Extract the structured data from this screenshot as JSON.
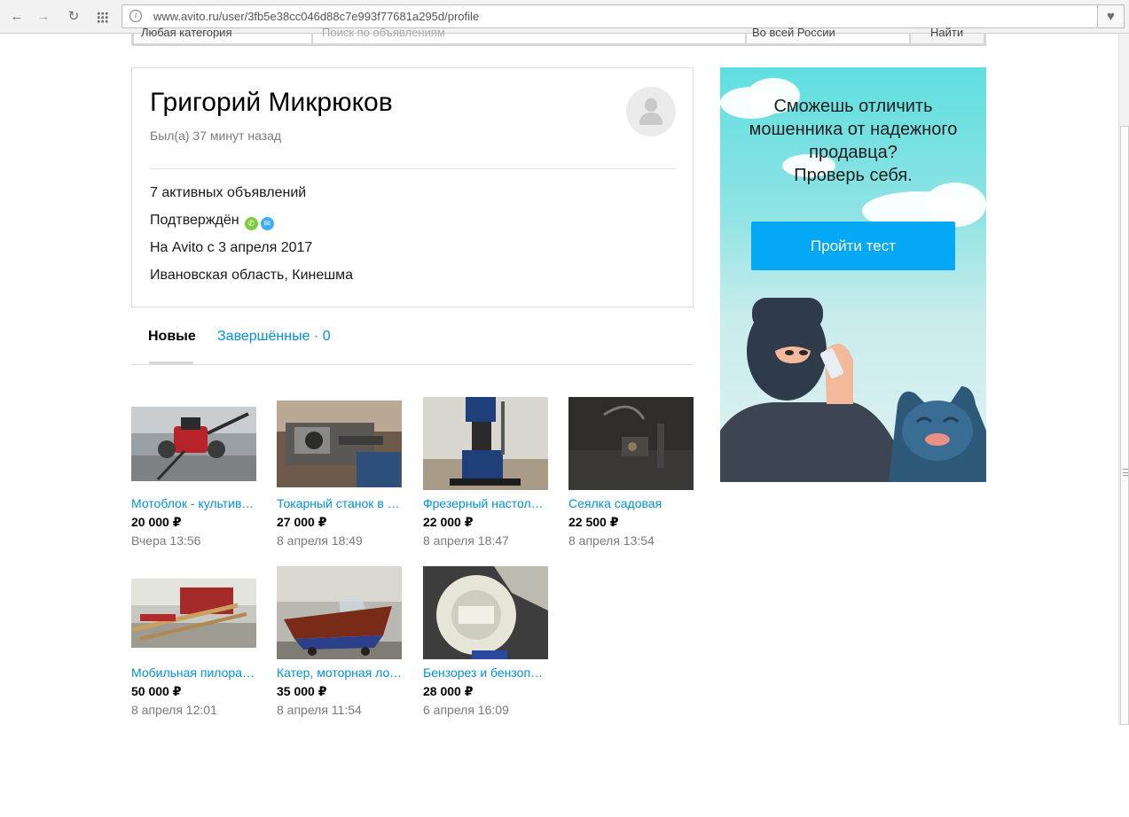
{
  "browser": {
    "url": "www.avito.ru/user/3fb5e38cc046d88c7e993f77681a295d/profile"
  },
  "search": {
    "category": "Любая категория",
    "query_placeholder": "Поиск по объявлениям",
    "region": "Во всей России",
    "button": "Найти"
  },
  "profile": {
    "name": "Григорий Микрюков",
    "last_seen": "Был(а) 37 минут назад",
    "active_ads": "7 активных объявлений",
    "verified_label": "Подтверждён",
    "since": "На Avito с 3 апреля 2017",
    "location": "Ивановская область, Кинешма"
  },
  "tabs": {
    "new": "Новые",
    "completed": "Завершённые · 0"
  },
  "listings": [
    {
      "title": "Мотоблок - культиватор",
      "price": "20 000 ₽",
      "date": "Вчера 13:56"
    },
    {
      "title": "Токарный станок в наличии",
      "price": "27 000 ₽",
      "date": "8 апреля 18:49"
    },
    {
      "title": "Фрезерный настольный станок",
      "price": "22 000 ₽",
      "date": "8 апреля 18:47"
    },
    {
      "title": "Сеялка садовая",
      "price": "22 500 ₽",
      "date": "8 апреля 13:54"
    },
    {
      "title": "Мобильная пилорама",
      "price": "50 000 ₽",
      "date": "8 апреля 12:01"
    },
    {
      "title": "Катер, моторная лодка",
      "price": "35 000 ₽",
      "date": "8 апреля 11:54"
    },
    {
      "title": "Бензорез и бензопила",
      "price": "28 000 ₽",
      "date": "6 апреля 16:09"
    }
  ],
  "ad": {
    "line1": "Сможешь отличить",
    "line2": "мошенника от надежного",
    "line3": "продавца?",
    "line4": "Проверь себя.",
    "button": "Пройти тест"
  },
  "colors": {
    "link": "#0091d9",
    "ad_button": "#04a8f5",
    "verified_phone": "#7ccb3b",
    "verified_mail": "#3aaef0"
  },
  "icons": [
    "back-arrow-icon",
    "forward-arrow-icon",
    "reload-icon",
    "apps-icon",
    "site-info-icon",
    "heart-icon",
    "user-avatar-icon",
    "phone-icon",
    "mail-icon"
  ]
}
